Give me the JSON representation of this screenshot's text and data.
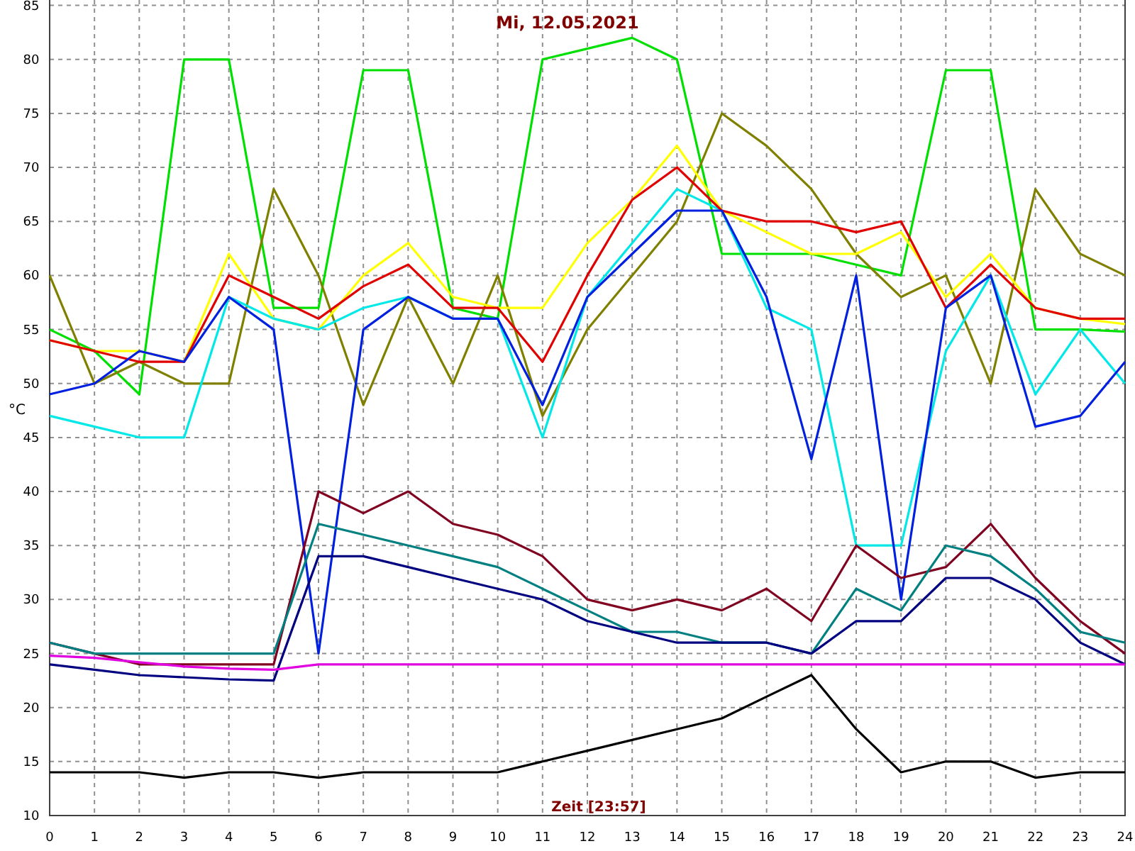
{
  "chart_data": {
    "type": "line",
    "title": "Mi, 12.05.2021",
    "xlabel": "Zeit [23:57]",
    "ylabel": "°C",
    "x": [
      0,
      1,
      2,
      3,
      4,
      5,
      6,
      7,
      8,
      9,
      10,
      11,
      12,
      13,
      14,
      15,
      16,
      17,
      18,
      19,
      20,
      21,
      22,
      23,
      24
    ],
    "xlim": [
      0,
      24
    ],
    "ylim": [
      10,
      85.5
    ],
    "grid": true,
    "xticks": [
      0,
      1,
      2,
      3,
      4,
      5,
      6,
      7,
      8,
      9,
      10,
      11,
      12,
      13,
      14,
      15,
      16,
      17,
      18,
      19,
      20,
      21,
      22,
      23,
      24
    ],
    "yticks": [
      10,
      15,
      20,
      25,
      30,
      35,
      40,
      45,
      50,
      55,
      60,
      65,
      70,
      75,
      80,
      85
    ],
    "series": [
      {
        "color": "#00e000",
        "values": [
          55,
          53,
          49,
          80,
          80,
          57,
          57,
          79,
          79,
          57,
          56,
          80,
          81,
          82,
          80,
          62,
          62,
          62,
          61,
          60,
          79,
          79,
          55,
          55,
          54.8
        ]
      },
      {
        "color": "#808000",
        "values": [
          60,
          50,
          52,
          50,
          50,
          68,
          60,
          48,
          58,
          50,
          60,
          47,
          55,
          60,
          65,
          75,
          72,
          68,
          62,
          58,
          60,
          50,
          68,
          62,
          60
        ]
      },
      {
        "color": "#ffff00",
        "values": [
          54,
          53,
          53,
          52,
          62,
          56,
          55,
          60,
          63,
          58,
          57,
          57,
          63,
          67,
          72,
          66,
          64,
          62,
          62,
          64,
          58,
          62,
          57,
          56,
          55.5
        ]
      },
      {
        "color": "#00e8e8",
        "values": [
          47,
          46,
          45,
          45,
          58,
          56,
          55,
          57,
          58,
          56,
          56,
          45,
          58,
          63,
          68,
          66,
          57,
          55,
          35,
          35,
          53,
          60,
          49,
          55,
          50
        ]
      },
      {
        "color": "#e00000",
        "values": [
          54,
          53,
          52,
          52,
          60,
          58,
          56,
          59,
          61,
          57,
          57,
          52,
          60,
          67,
          70,
          66,
          65,
          65,
          64,
          65,
          57,
          61,
          57,
          56,
          56
        ]
      },
      {
        "color": "#0020e0",
        "values": [
          49,
          50,
          53,
          52,
          58,
          55,
          25,
          55,
          58,
          56,
          56,
          48,
          58,
          62,
          66,
          66,
          58,
          43,
          60,
          30,
          57,
          60,
          46,
          47,
          52
        ]
      },
      {
        "color": "#800020",
        "values": [
          26,
          25,
          24,
          24,
          24,
          24,
          40,
          38,
          40,
          37,
          36,
          34,
          30,
          29,
          30,
          29,
          31,
          28,
          35,
          32,
          33,
          37,
          32,
          28,
          25
        ]
      },
      {
        "color": "#008080",
        "values": [
          26,
          25,
          25,
          25,
          25,
          25,
          37,
          36,
          35,
          34,
          33,
          31,
          29,
          27,
          27,
          26,
          26,
          25,
          31,
          29,
          35,
          34,
          31,
          27,
          26
        ]
      },
      {
        "color": "#000080",
        "values": [
          24,
          23.5,
          23,
          22.8,
          22.6,
          22.5,
          34,
          34,
          33,
          32,
          31,
          30,
          28,
          27,
          26,
          26,
          26,
          25,
          28,
          28,
          32,
          32,
          30,
          26,
          24
        ]
      },
      {
        "color": "#e000e0",
        "values": [
          24.8,
          24.6,
          24.2,
          23.8,
          23.6,
          23.5,
          24,
          24,
          24,
          24,
          24,
          24,
          24,
          24,
          24,
          24,
          24,
          24,
          24,
          24,
          24,
          24,
          24,
          24,
          24
        ]
      },
      {
        "color": "#000000",
        "values": [
          14,
          14,
          14,
          13.5,
          14,
          14,
          13.5,
          14,
          14,
          14,
          14,
          15,
          16,
          17,
          18,
          19,
          21,
          23,
          18,
          14,
          15,
          15,
          13.5,
          14,
          14
        ]
      }
    ]
  }
}
